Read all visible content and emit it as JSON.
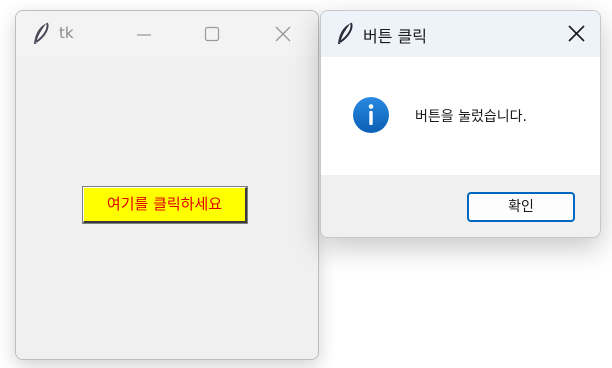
{
  "tk_window": {
    "title": "tk",
    "icon": "feather-icon",
    "title_buttons": [
      "minimize-icon",
      "maximize-icon",
      "close-icon"
    ],
    "button_label": "여기를 클릭하세요",
    "colors": {
      "button_bg": "#ffff00",
      "button_fg": "#e00000",
      "client_bg": "#f0f0f0"
    }
  },
  "message_box": {
    "title": "버튼 클릭",
    "icon": "info-icon",
    "message": "버튼을 눌렀습니다.",
    "ok_label": "확인",
    "colors": {
      "accent": "#0067c0",
      "info": "#1a73c9"
    }
  }
}
